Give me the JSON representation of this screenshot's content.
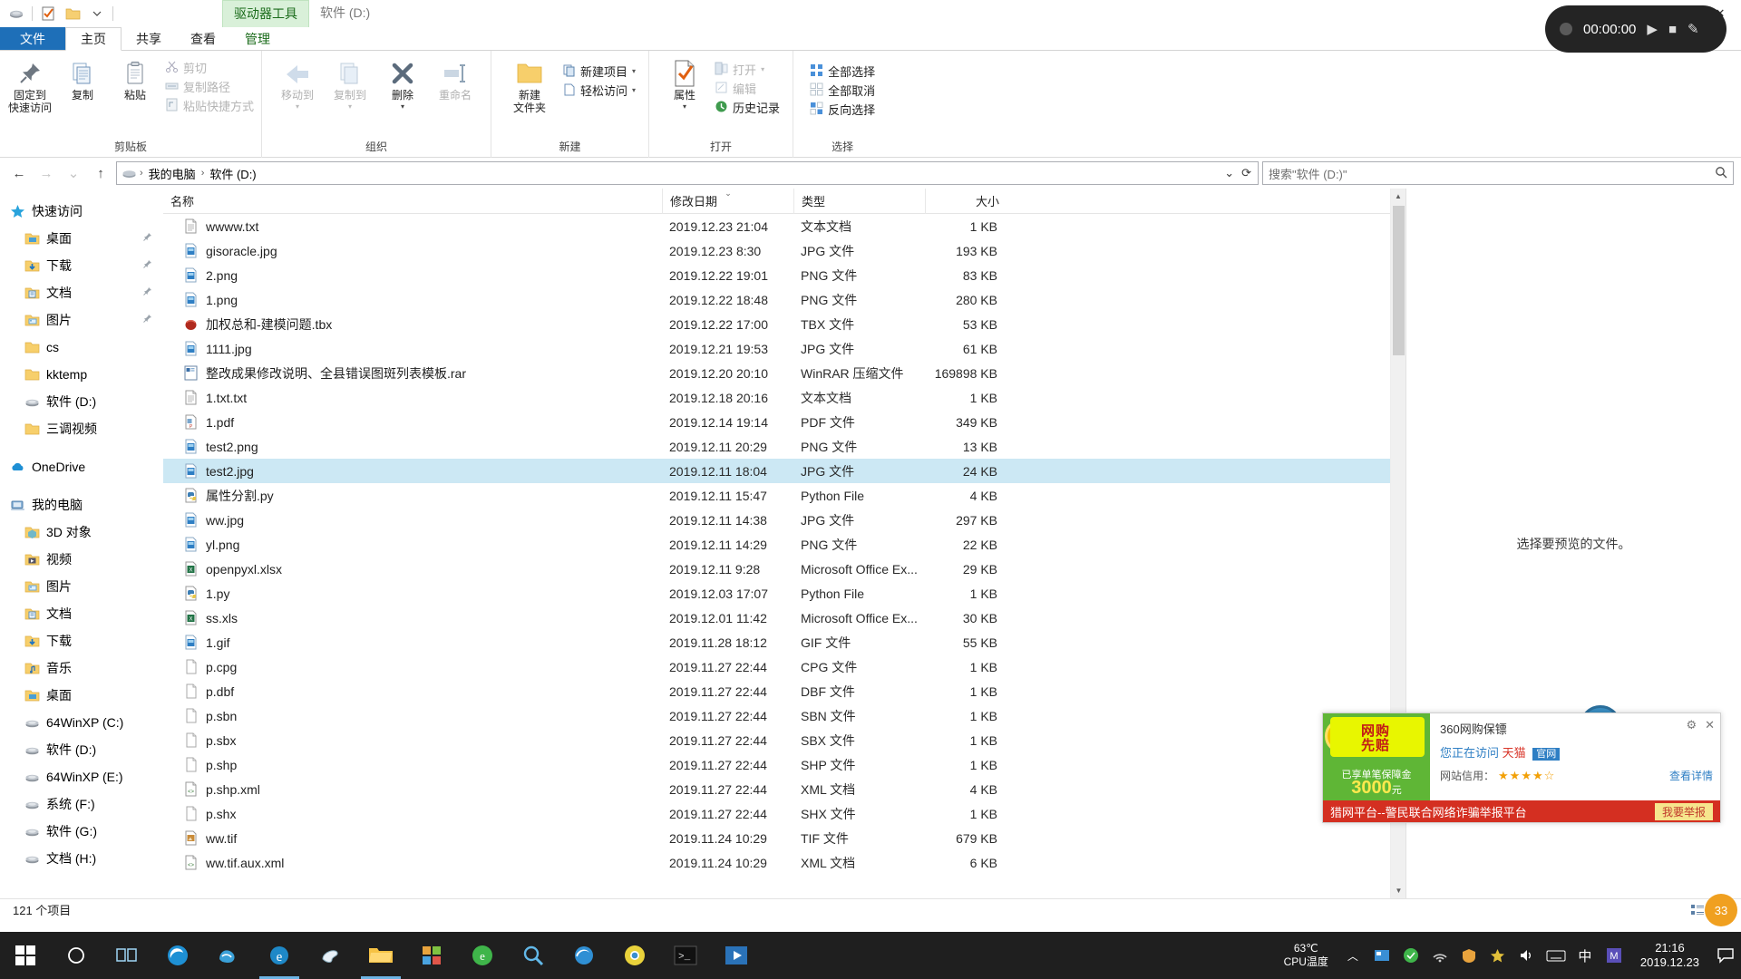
{
  "window": {
    "context_tab": "驱动器工具",
    "context_tab2": "软件 (D:)",
    "minimize": "—",
    "maximize": "❐",
    "close": "✕"
  },
  "recorder": {
    "time": "00:00:00",
    "play": "▶",
    "stop": "■",
    "edit": "✎"
  },
  "ribbon_tabs": [
    {
      "label": "文件",
      "id": "file"
    },
    {
      "label": "主页",
      "id": "home"
    },
    {
      "label": "共享",
      "id": "share"
    },
    {
      "label": "查看",
      "id": "view"
    },
    {
      "label": "管理",
      "id": "manage"
    }
  ],
  "ribbon": {
    "groups": [
      {
        "label": "剪贴板",
        "big": [
          {
            "label": "固定到\n快速访问",
            "icon": "pin-icon",
            "dim": false
          },
          {
            "label": "复制",
            "icon": "copy-icon",
            "dim": false
          },
          {
            "label": "粘贴",
            "icon": "paste-icon",
            "dim": false
          }
        ],
        "small": [
          {
            "label": "剪切",
            "icon": "scissors-icon",
            "dim": true
          },
          {
            "label": "复制路径",
            "icon": "copy-path-icon",
            "dim": true
          },
          {
            "label": "粘贴快捷方式",
            "icon": "paste-shortcut-icon",
            "dim": true
          }
        ]
      },
      {
        "label": "组织",
        "big": [
          {
            "label": "移动到",
            "icon": "move-to-icon",
            "dim": true,
            "caret": true
          },
          {
            "label": "复制到",
            "icon": "copy-to-icon",
            "dim": true,
            "caret": true
          },
          {
            "label": "删除",
            "icon": "delete-icon",
            "dim": false,
            "caret": true
          },
          {
            "label": "重命名",
            "icon": "rename-icon",
            "dim": true
          }
        ],
        "small": []
      },
      {
        "label": "新建",
        "big": [
          {
            "label": "新建\n文件夹",
            "icon": "new-folder-icon",
            "dim": false
          }
        ],
        "small": [
          {
            "label": "新建项目",
            "icon": "new-item-icon",
            "dim": false,
            "caret": true
          },
          {
            "label": "轻松访问",
            "icon": "easy-access-icon",
            "dim": false,
            "caret": true
          }
        ]
      },
      {
        "label": "打开",
        "big": [
          {
            "label": "属性",
            "icon": "properties-icon",
            "dim": false,
            "caret": true
          }
        ],
        "small": [
          {
            "label": "打开",
            "icon": "open-icon",
            "dim": true,
            "caret": true
          },
          {
            "label": "编辑",
            "icon": "edit-icon",
            "dim": true
          },
          {
            "label": "历史记录",
            "icon": "history-icon",
            "dim": false
          }
        ]
      },
      {
        "label": "选择",
        "big": [],
        "small": [
          {
            "label": "全部选择",
            "icon": "select-all-icon",
            "dim": false
          },
          {
            "label": "全部取消",
            "icon": "select-none-icon",
            "dim": false
          },
          {
            "label": "反向选择",
            "icon": "invert-selection-icon",
            "dim": false
          }
        ]
      }
    ]
  },
  "addressbar": {
    "back": "←",
    "forward": "→",
    "recent": "⌄",
    "up": "↑",
    "crumbs": [
      "我的电脑",
      "软件 (D:)"
    ],
    "dropdown": "⌄",
    "refresh": "⟳",
    "search_placeholder": "搜索\"软件 (D:)\"",
    "search_icon": "search-icon"
  },
  "navpane": [
    {
      "label": "快速访问",
      "icon": "star-icon",
      "level": 0,
      "pinned": false
    },
    {
      "label": "桌面",
      "icon": "desktop-folder-icon",
      "level": 1,
      "pinned": true
    },
    {
      "label": "下载",
      "icon": "downloads-folder-icon",
      "level": 1,
      "pinned": true
    },
    {
      "label": "文档",
      "icon": "documents-folder-icon",
      "level": 1,
      "pinned": true
    },
    {
      "label": "图片",
      "icon": "pictures-folder-icon",
      "level": 1,
      "pinned": true
    },
    {
      "label": "cs",
      "icon": "folder-icon",
      "level": 1,
      "pinned": false
    },
    {
      "label": "kktemp",
      "icon": "folder-icon",
      "level": 1,
      "pinned": false
    },
    {
      "label": "软件 (D:)",
      "icon": "drive-icon",
      "level": 1,
      "pinned": false
    },
    {
      "label": "三调视频",
      "icon": "folder-icon",
      "level": 1,
      "pinned": false
    },
    {
      "label": "",
      "icon": "spacer",
      "level": 0,
      "pinned": false
    },
    {
      "label": "OneDrive",
      "icon": "onedrive-icon",
      "level": 0,
      "pinned": false
    },
    {
      "label": "",
      "icon": "spacer",
      "level": 0,
      "pinned": false
    },
    {
      "label": "我的电脑",
      "icon": "this-pc-icon",
      "level": 0,
      "pinned": false
    },
    {
      "label": "3D 对象",
      "icon": "3d-objects-icon",
      "level": 1,
      "pinned": false
    },
    {
      "label": "视频",
      "icon": "videos-folder-icon",
      "level": 1,
      "pinned": false
    },
    {
      "label": "图片",
      "icon": "pictures-folder-icon",
      "level": 1,
      "pinned": false
    },
    {
      "label": "文档",
      "icon": "documents-folder-icon",
      "level": 1,
      "pinned": false
    },
    {
      "label": "下载",
      "icon": "downloads-folder-icon",
      "level": 1,
      "pinned": false
    },
    {
      "label": "音乐",
      "icon": "music-folder-icon",
      "level": 1,
      "pinned": false
    },
    {
      "label": "桌面",
      "icon": "desktop-folder-icon",
      "level": 1,
      "pinned": false
    },
    {
      "label": "64WinXP (C:)",
      "icon": "drive-icon",
      "level": 1,
      "pinned": false
    },
    {
      "label": "软件 (D:)",
      "icon": "drive-icon",
      "level": 1,
      "pinned": false
    },
    {
      "label": "64WinXP (E:)",
      "icon": "drive-icon",
      "level": 1,
      "pinned": false
    },
    {
      "label": "系统 (F:)",
      "icon": "drive-icon",
      "level": 1,
      "pinned": false
    },
    {
      "label": "软件 (G:)",
      "icon": "drive-icon",
      "level": 1,
      "pinned": false
    },
    {
      "label": "文档 (H:)",
      "icon": "drive-icon",
      "level": 1,
      "pinned": false
    }
  ],
  "columns": [
    {
      "key": "name",
      "label": "名称"
    },
    {
      "key": "date",
      "label": "修改日期"
    },
    {
      "key": "type",
      "label": "类型"
    },
    {
      "key": "size",
      "label": "大小"
    }
  ],
  "sort": {
    "column": "date",
    "direction": "desc",
    "glyph": "⌄"
  },
  "files": [
    {
      "name": "wwww.txt",
      "date": "2019.12.23 21:04",
      "type": "文本文档",
      "size": "1 KB",
      "icon": "txt-file-icon",
      "selected": false
    },
    {
      "name": "gisoracle.jpg",
      "date": "2019.12.23 8:30",
      "type": "JPG 文件",
      "size": "193 KB",
      "icon": "image-file-icon",
      "selected": false
    },
    {
      "name": "2.png",
      "date": "2019.12.22 19:01",
      "type": "PNG 文件",
      "size": "83 KB",
      "icon": "image-file-icon",
      "selected": false
    },
    {
      "name": "1.png",
      "date": "2019.12.22 18:48",
      "type": "PNG 文件",
      "size": "280 KB",
      "icon": "image-file-icon",
      "selected": false
    },
    {
      "name": "加权总和-建模问题.tbx",
      "date": "2019.12.22 17:00",
      "type": "TBX 文件",
      "size": "53 KB",
      "icon": "toolbox-file-icon",
      "selected": false
    },
    {
      "name": "1111.jpg",
      "date": "2019.12.21 19:53",
      "type": "JPG 文件",
      "size": "61 KB",
      "icon": "image-file-icon",
      "selected": false
    },
    {
      "name": "整改成果修改说明、全县错误图斑列表模板.rar",
      "date": "2019.12.20 20:10",
      "type": "WinRAR 压缩文件",
      "size": "169898 KB",
      "icon": "rar-file-icon",
      "selected": false
    },
    {
      "name": "1.txt.txt",
      "date": "2019.12.18 20:16",
      "type": "文本文档",
      "size": "1 KB",
      "icon": "txt-file-icon",
      "selected": false
    },
    {
      "name": "1.pdf",
      "date": "2019.12.14 19:14",
      "type": "PDF 文件",
      "size": "349 KB",
      "icon": "pdf-file-icon",
      "selected": false
    },
    {
      "name": "test2.png",
      "date": "2019.12.11 20:29",
      "type": "PNG 文件",
      "size": "13 KB",
      "icon": "image-file-icon",
      "selected": false
    },
    {
      "name": "test2.jpg",
      "date": "2019.12.11 18:04",
      "type": "JPG 文件",
      "size": "24 KB",
      "icon": "image-file-icon",
      "selected": true
    },
    {
      "name": "属性分割.py",
      "date": "2019.12.11 15:47",
      "type": "Python File",
      "size": "4 KB",
      "icon": "python-file-icon",
      "selected": false
    },
    {
      "name": "ww.jpg",
      "date": "2019.12.11 14:38",
      "type": "JPG 文件",
      "size": "297 KB",
      "icon": "image-file-icon",
      "selected": false
    },
    {
      "name": "yl.png",
      "date": "2019.12.11 14:29",
      "type": "PNG 文件",
      "size": "22 KB",
      "icon": "image-file-icon",
      "selected": false
    },
    {
      "name": "openpyxl.xlsx",
      "date": "2019.12.11 9:28",
      "type": "Microsoft Office Ex...",
      "size": "29 KB",
      "icon": "excel-file-icon",
      "selected": false
    },
    {
      "name": "1.py",
      "date": "2019.12.03 17:07",
      "type": "Python File",
      "size": "1 KB",
      "icon": "python-file-icon",
      "selected": false
    },
    {
      "name": "ss.xls",
      "date": "2019.12.01 11:42",
      "type": "Microsoft Office Ex...",
      "size": "30 KB",
      "icon": "excel-file-icon",
      "selected": false
    },
    {
      "name": "1.gif",
      "date": "2019.11.28 18:12",
      "type": "GIF 文件",
      "size": "55 KB",
      "icon": "image-file-icon",
      "selected": false
    },
    {
      "name": "p.cpg",
      "date": "2019.11.27 22:44",
      "type": "CPG 文件",
      "size": "1 KB",
      "icon": "generic-file-icon",
      "selected": false
    },
    {
      "name": "p.dbf",
      "date": "2019.11.27 22:44",
      "type": "DBF 文件",
      "size": "1 KB",
      "icon": "generic-file-icon",
      "selected": false
    },
    {
      "name": "p.sbn",
      "date": "2019.11.27 22:44",
      "type": "SBN 文件",
      "size": "1 KB",
      "icon": "generic-file-icon",
      "selected": false
    },
    {
      "name": "p.sbx",
      "date": "2019.11.27 22:44",
      "type": "SBX 文件",
      "size": "1 KB",
      "icon": "generic-file-icon",
      "selected": false
    },
    {
      "name": "p.shp",
      "date": "2019.11.27 22:44",
      "type": "SHP 文件",
      "size": "1 KB",
      "icon": "generic-file-icon",
      "selected": false
    },
    {
      "name": "p.shp.xml",
      "date": "2019.11.27 22:44",
      "type": "XML 文档",
      "size": "4 KB",
      "icon": "xml-file-icon",
      "selected": false
    },
    {
      "name": "p.shx",
      "date": "2019.11.27 22:44",
      "type": "SHX 文件",
      "size": "1 KB",
      "icon": "generic-file-icon",
      "selected": false
    },
    {
      "name": "ww.tif",
      "date": "2019.11.24 10:29",
      "type": "TIF 文件",
      "size": "679 KB",
      "icon": "tif-file-icon",
      "selected": false
    },
    {
      "name": "ww.tif.aux.xml",
      "date": "2019.11.24 10:29",
      "type": "XML 文档",
      "size": "6 KB",
      "icon": "xml-file-icon",
      "selected": false
    }
  ],
  "preview": {
    "message": "选择要预览的文件。"
  },
  "statusbar": {
    "count": "121 个项目",
    "view_details": "details-view-icon",
    "view_tiles": "tiles-view-icon"
  },
  "ad": {
    "badge": "网购\n先赔",
    "guarantee_label": "已享单笔保障金",
    "amount": "3000",
    "amount_unit": "元",
    "title": "360网购保镖",
    "visiting": "您正在访问",
    "site": "天猫",
    "official": "官网",
    "credit_label": "网站信用：",
    "stars": "★★★★☆",
    "detail": "查看详情",
    "footer": "猎网平台--警民联合网络诈骗举报平台",
    "report": "我要举报",
    "gear": "⚙",
    "close": "✕"
  },
  "gauge": {
    "percent": "33",
    "percent_sign": "%",
    "temp": "63℃"
  },
  "taskbar": {
    "start": "start-icon",
    "search": "cortana-icon",
    "apps": [
      "task-view-icon",
      "edge-browser-icon",
      "explorer-icon",
      "store-icon",
      "browser-360-icon",
      "search-app-icon",
      "chrome-icon",
      "firefox-icon",
      "terminal-icon",
      "media-player-icon"
    ],
    "temp_value": "63℃",
    "temp_label": "CPU温度",
    "tray_caret": "︿",
    "clock_time": "21:16",
    "clock_date": "2019.12.23",
    "ime": "中",
    "notification": "notification-icon"
  }
}
